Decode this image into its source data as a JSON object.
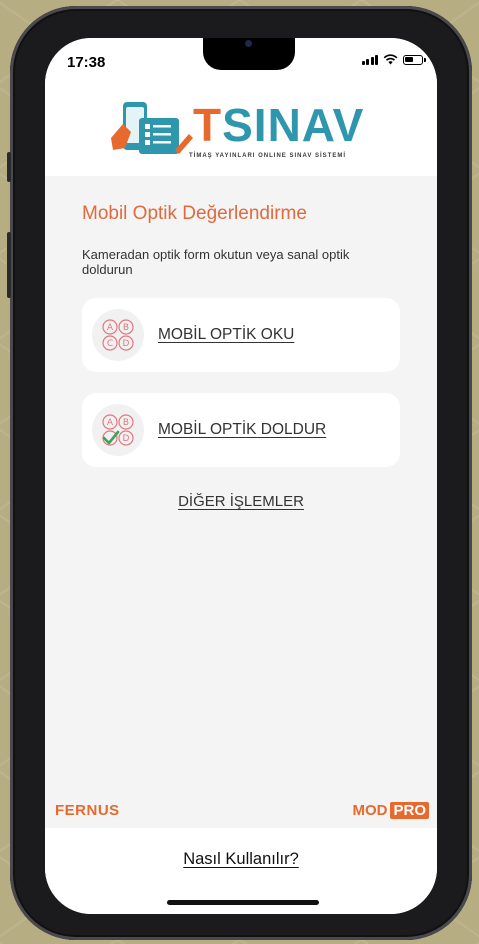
{
  "status_bar": {
    "time": "17:38"
  },
  "logo": {
    "brand_t": "T",
    "brand_name": "SINAV",
    "tagline": "TİMAŞ YAYINLARI ONLINE SINAV SİSTEMİ"
  },
  "main": {
    "title": "Mobil Optik Değerlendirme",
    "description": "Kameradan optik form okutun veya sanal optik doldurun",
    "options": [
      {
        "label": "MOBİL OPTİK OKU",
        "icon": "abcd-bubbles-icon"
      },
      {
        "label": "MOBİL OPTİK DOLDUR",
        "icon": "abcd-bubbles-check-icon"
      }
    ],
    "other_link": "DİĞER İŞLEMLER"
  },
  "footer": {
    "left_brand": "FERNUS",
    "right_brand_a": "MOD",
    "right_brand_b": "PRO",
    "help_link": "Nasıl Kullanılır?"
  },
  "colors": {
    "accent": "#e8692d",
    "teal": "#2f97ad",
    "background": "#f4f4f4"
  }
}
